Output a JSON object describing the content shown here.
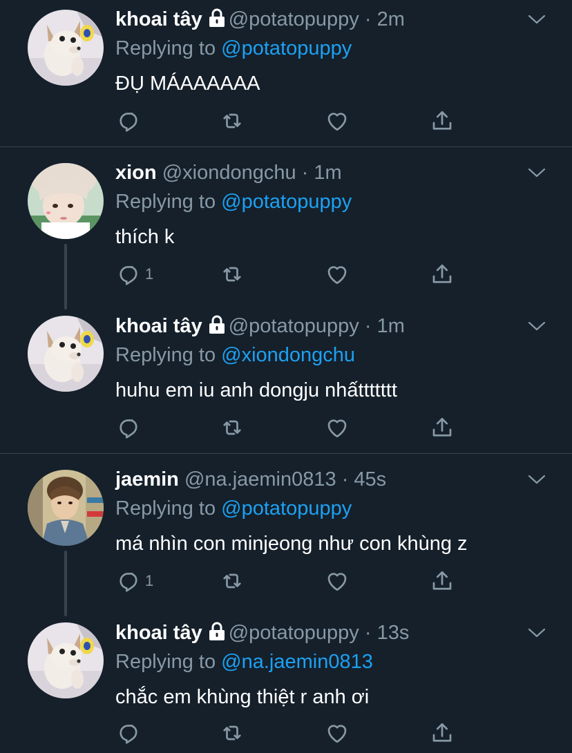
{
  "tweets": [
    {
      "name": "khoai tây",
      "locked": true,
      "handle": "@potatopuppy",
      "time": "2m",
      "replying_prefix": "Replying to",
      "replying_to": "@potatopuppy",
      "text": "ĐỤ MÁAAAAAA",
      "reply_count": "",
      "avatar": "puppy"
    },
    {
      "name": "xion",
      "locked": false,
      "handle": "@xiondongchu",
      "time": "1m",
      "replying_prefix": "Replying to",
      "replying_to": "@potatopuppy",
      "text": "thích k",
      "reply_count": "1",
      "avatar": "xion"
    },
    {
      "name": "khoai tây",
      "locked": true,
      "handle": "@potatopuppy",
      "time": "1m",
      "replying_prefix": "Replying to",
      "replying_to": "@xiondongchu",
      "text": "huhu em iu anh dongju nhấttttttt",
      "reply_count": "",
      "avatar": "puppy"
    },
    {
      "name": "jaemin",
      "locked": false,
      "handle": "@na.jaemin0813",
      "time": "45s",
      "replying_prefix": "Replying to",
      "replying_to": "@potatopuppy",
      "text": "má nhìn con minjeong như con khùng z",
      "reply_count": "1",
      "avatar": "jaemin"
    },
    {
      "name": "khoai tây",
      "locked": true,
      "handle": "@potatopuppy",
      "time": "13s",
      "replying_prefix": "Replying to",
      "replying_to": "@na.jaemin0813",
      "text": "chắc em khùng thiệt r anh ơi",
      "reply_count": "",
      "avatar": "puppy"
    }
  ],
  "icons": {
    "reply": "reply-icon",
    "retweet": "retweet-icon",
    "like": "heart-icon",
    "share": "share-icon",
    "menu": "chevron-down-icon",
    "lock": "lock-icon"
  },
  "colors": {
    "background": "#15202b",
    "secondary_text": "#8899a6",
    "mention": "#1da1f2",
    "divider": "#38444d"
  }
}
